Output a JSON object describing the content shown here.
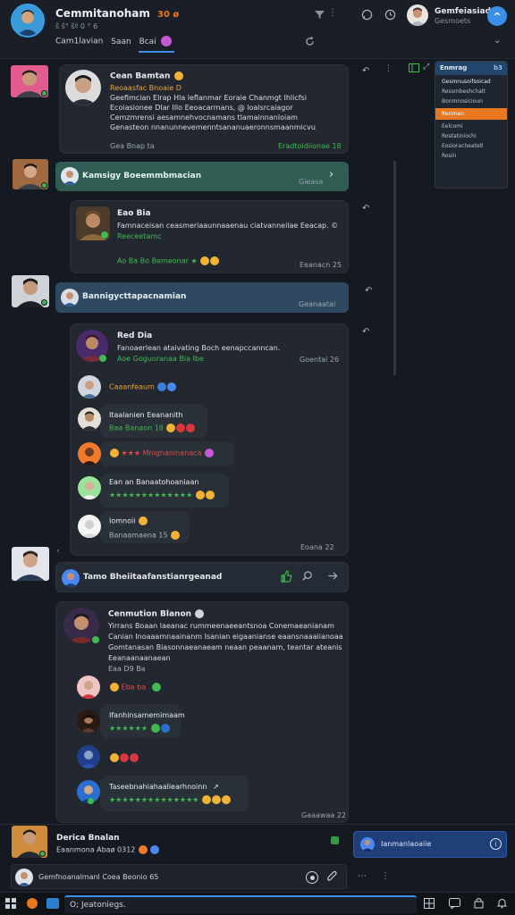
{
  "header": {
    "title": "Cemmitanoham",
    "subtitle": "š š° šº 0 ° 6",
    "title_tag": "30 ø",
    "user_name": "Gemfeiasiad",
    "user_status": "Gesmoets",
    "nav_tabs": [
      "Cam1lavian",
      "Saan",
      "Bcai"
    ]
  },
  "right_panel": {
    "title": "Enmrag",
    "badge": "b3",
    "items": [
      "Gesmnusoifsoicad",
      "Ressmbeshchalt",
      "Bonmnosicioun",
      "Rerimen",
      "Eelcomi",
      "Rostatiniochi",
      "Eosioracheatetl",
      "Rosin"
    ],
    "highlight_index": 3
  },
  "messages": [
    {
      "name": "Cean Bamtan",
      "lines": [
        "Reoaasfac Bnoaie D",
        "Geefimcian Elrap Hla leflanmar Eoraie Chanmgt Ihlicfsi",
        "Ecoiasionee Dlar Illo Eeoacarmans, @ loalsrcaiagor",
        "Cemzmrensi aesamnehvocnamans tlamainnanloiam",
        "Genasteon nnanunnevemenntsananuaeronnsmaanmicvu"
      ],
      "time": "Gea Bnap ta",
      "reactions": "Eradtoidiionae 18"
    },
    {
      "banner": "Kamsigy Boeemmbmacian",
      "banner_time": "Gieasa"
    },
    {
      "name": "Eao Bia",
      "lines": [
        "Famnaceisan ceasmeriaaunnaaenau ciatvanneilae Eeacap. ©",
        "Reeceetamc"
      ],
      "stars": "Ao Ba Bo Bemeonar ★",
      "time": "Eeanacn 25"
    },
    {
      "banner": "Bannigycttapacnamian",
      "banner_time": "Geanaatai"
    },
    {
      "name": "Red Dia",
      "lines": [
        "Fanoaerlean ataivating Boch eenapccanncan.",
        "Aoe Goguoranaa Bia Ibe"
      ],
      "time": "Goentai 26"
    },
    {
      "nested": [
        {
          "text": "Caaanfeaum"
        },
        {
          "name": "Itaalanien Eeananith",
          "text": "Baa Banaon 18"
        },
        {
          "text": "★★★ Mnighaninanaca"
        },
        {
          "name": "Ean an Banaatohoaniaan",
          "text": "★★★★★★★★★★★★★"
        },
        {
          "text": "Iomnoii",
          "sub": "Banaamaena 15"
        }
      ],
      "time": "Eoana 22"
    },
    {
      "banner": "Tamo Bheiitaafanstianrgeanad"
    },
    {
      "name": "Cenmution Blanon",
      "lines": [
        "Yirrans Boaan laeanac rummeenaeeantsnoa Conemaeanianam",
        "Canian Inoaaamnaainanm Isanian eigaanianse eaansnaaaiianoaamn",
        "Gomtanasan Biasonnaeanaeam neaan peaanam, teantar ateanisanaenean",
        "Eeanaanaanaean"
      ],
      "sub": "Eaa D9 Ba",
      "nested": [
        {
          "text": "Eba ba"
        },
        {
          "name": "Ifanhinsamemimaam",
          "text": "★★★★★★"
        },
        {
          "text": ""
        },
        {
          "name": "Taseebnahiahaaliearhnoinn",
          "text": "★★★★★★★★★★★★★★"
        }
      ],
      "time": "Gaaawaa 22"
    }
  ],
  "bottom": {
    "name": "Derica Bnalan",
    "desc": "Eaanmona Abaø 0312",
    "notif": "Ianmanlaoaiie",
    "composer": "Gemfnoanalmanl Coea Beonio 65",
    "search_placeholder": "O; Jeatoniegs."
  },
  "colors": {
    "accent_blue": "#3b8fe8",
    "orange": "#e8771f",
    "green": "#3fb950",
    "banner_green": "#2f5c53",
    "banner_blue": "#2f4a60"
  }
}
